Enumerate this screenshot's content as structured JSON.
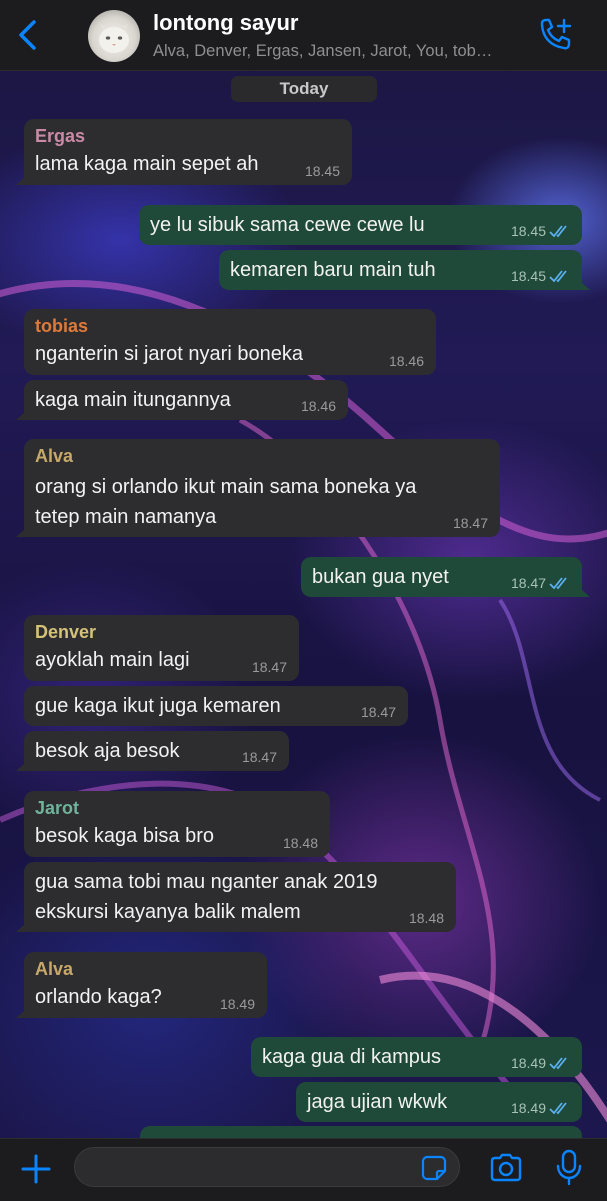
{
  "header": {
    "title": "lontong sayur",
    "members": "Alva, Denver, Ergas, Jansen, Jarot, You, tob…"
  },
  "date_label": "Today",
  "messages": [
    {
      "dir": "in",
      "sender": "Ergas",
      "sender_color": "#c98aa6",
      "lines": [
        "lama kaga main sepet ah"
      ],
      "time": "18.45"
    },
    {
      "dir": "out",
      "lines": [
        "ye lu sibuk sama cewe cewe lu"
      ],
      "time": "18.45",
      "status": "read"
    },
    {
      "dir": "out",
      "lines": [
        "kemaren baru main tuh"
      ],
      "time": "18.45",
      "status": "read"
    },
    {
      "dir": "in",
      "sender": "tobias",
      "sender_color": "#e07a3a",
      "lines": [
        "nganterin si jarot nyari boneka"
      ],
      "time": "18.46"
    },
    {
      "dir": "in",
      "lines": [
        "kaga main itungannya"
      ],
      "time": "18.46"
    },
    {
      "dir": "in",
      "sender": "Alva",
      "sender_color": "#c7a86a",
      "lines": [
        "orang si orlando ikut main sama boneka ya",
        "tetep main namanya"
      ],
      "time": "18.47"
    },
    {
      "dir": "out",
      "lines": [
        "bukan gua nyet"
      ],
      "time": "18.47",
      "status": "read"
    },
    {
      "dir": "in",
      "sender": "Denver",
      "sender_color": "#d4c27a",
      "lines": [
        "ayoklah main lagi"
      ],
      "time": "18.47"
    },
    {
      "dir": "in",
      "lines": [
        "gue kaga ikut juga kemaren"
      ],
      "time": "18.47"
    },
    {
      "dir": "in",
      "lines": [
        "besok aja besok"
      ],
      "time": "18.47"
    },
    {
      "dir": "in",
      "sender": "Jarot",
      "sender_color": "#6fb39a",
      "lines": [
        "besok kaga bisa bro"
      ],
      "time": "18.48"
    },
    {
      "dir": "in",
      "lines": [
        "gua sama tobi mau nganter anak 2019",
        "ekskursi kayanya balik malem"
      ],
      "time": "18.48"
    },
    {
      "dir": "in",
      "sender": "Alva",
      "sender_color": "#c7a86a",
      "lines": [
        "orlando kaga?"
      ],
      "time": "18.49"
    },
    {
      "dir": "out",
      "lines": [
        "kaga gua di kampus"
      ],
      "time": "18.49",
      "status": "read"
    },
    {
      "dir": "out",
      "lines": [
        "jaga ujian wkwk"
      ],
      "time": "18.49",
      "status": "read"
    }
  ],
  "composer": {
    "placeholder": ""
  },
  "colors": {
    "accent": "#0a84ff",
    "incoming": "#2d2d30",
    "outgoing": "#1f4a39",
    "read_ticks": "#5ab0f0"
  },
  "icons": [
    "back-chevron-icon",
    "add-call-icon",
    "plus-icon",
    "sticker-icon",
    "camera-icon",
    "microphone-icon",
    "read-ticks-icon"
  ]
}
